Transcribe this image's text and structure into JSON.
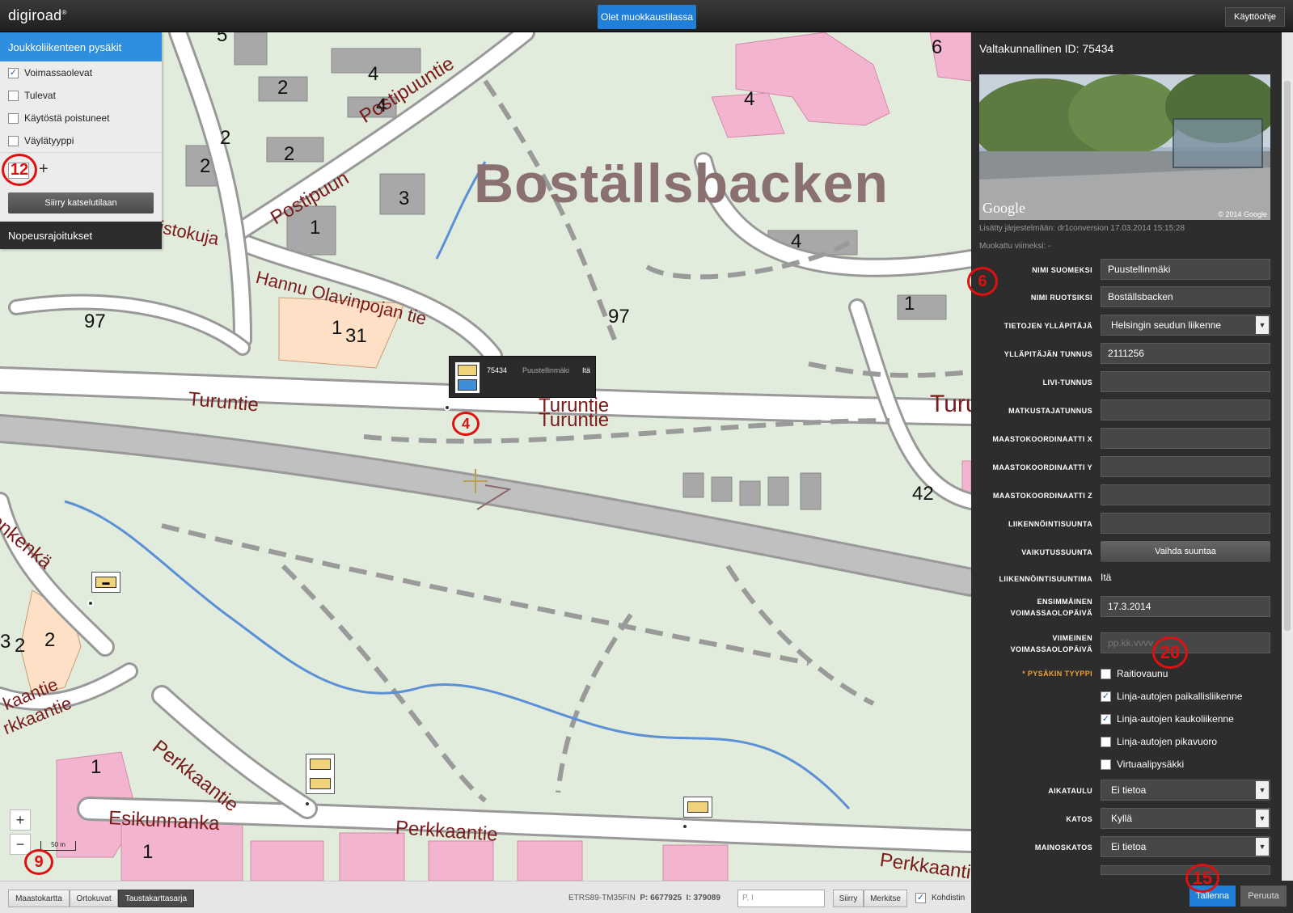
{
  "app": {
    "logo": "digiroad",
    "logo_mark": "®",
    "edit_mode": "Olet muokkaustilassa",
    "help": "Käyttöohje"
  },
  "legend": {
    "title": "Joukkoliikenteen pysäkit",
    "items": [
      {
        "label": "Voimassaolevat",
        "checked": true
      },
      {
        "label": "Tulevat",
        "checked": false
      },
      {
        "label": "Käytöstä poistuneet",
        "checked": false
      },
      {
        "label": "Väylätyyppi",
        "checked": false
      }
    ],
    "add": "+",
    "move_button": "Siirry katselutilaan",
    "second_title": "Nopeusrajoitukset"
  },
  "map": {
    "place_name": "Boställsbacken",
    "roads": [
      "Postipuuntie",
      "Postipuun",
      "Hannu Olavinpojan tie",
      "Turuntie",
      "Turuntie",
      "Turuntie",
      "Perkkaantie",
      "Perkkaantie",
      "Perkkaantie",
      "Esikunnanka",
      "Turu",
      "istokuja",
      "enkenkä",
      "kaantie",
      "rkkaantie"
    ],
    "numbers": [
      "5",
      "4",
      "2",
      "4",
      "2",
      "2",
      "2",
      "3",
      "1",
      "97",
      "1",
      "31",
      "97",
      "4",
      "4",
      "1",
      "6",
      "42",
      "3",
      "2",
      "2",
      "1",
      "1"
    ],
    "popup": {
      "id": "75434",
      "name": "Puustellinmäki",
      "direction": "Itä"
    },
    "scale_label": "50 m",
    "zoom_in": "+",
    "zoom_out": "−"
  },
  "annotations": [
    "12",
    "4",
    "6",
    "9",
    "20",
    "15"
  ],
  "panel": {
    "title": "Valtakunnallinen ID: 75434",
    "streetview_brand": "Google",
    "streetview_copyright": "© 2014 Google",
    "added": "Lisätty järjestelmään: dr1conversion 17.03.2014 15:15:28",
    "modified": "Muokattu viimeksi: -",
    "fields": {
      "nimi_fi": {
        "label": "NIMI SUOMEKSI",
        "value": "Puustellinmäki"
      },
      "nimi_sv": {
        "label": "NIMI RUOTSIKSI",
        "value": "Boställsbacken"
      },
      "yllapitaja": {
        "label": "TIETOJEN YLLÄPITÄJÄ",
        "value": "Helsingin seudun liikenne"
      },
      "tunnus": {
        "label": "YLLÄPITÄJÄN TUNNUS",
        "value": "2111256"
      },
      "livi": {
        "label": "LIVI-TUNNUS",
        "value": ""
      },
      "matkustaja": {
        "label": "MATKUSTAJATUNNUS",
        "value": ""
      },
      "x": {
        "label": "MAASTOKOORDINAATTI X",
        "value": ""
      },
      "y": {
        "label": "MAASTOKOORDINAATTI Y",
        "value": ""
      },
      "z": {
        "label": "MAASTOKOORDINAATTI Z",
        "value": ""
      },
      "suunta": {
        "label": "LIIKENNÖINTISUUNTA",
        "value": ""
      },
      "vaikutus": {
        "label": "VAIKUTUSSUUNTA",
        "button": "Vaihda suuntaa"
      },
      "suuntima": {
        "label": "LIIKENNÖINTISUUNTIMA",
        "value": "Itä"
      },
      "ensimmainen": {
        "label1": "ENSIMMÄINEN",
        "label2": "VOIMASSAOLOPÄIVÄ",
        "value": "17.3.2014"
      },
      "viimeinen": {
        "label1": "VIIMEINEN",
        "label2": "VOIMASSAOLOPÄIVÄ",
        "placeholder": "pp.kk.vvvv"
      },
      "tyyppi": {
        "label": "* PYSÄKIN TYYPPI",
        "options": [
          {
            "label": "Raitiovaunu",
            "checked": false
          },
          {
            "label": "Linja-autojen paikallisliikenne",
            "checked": true
          },
          {
            "label": "Linja-autojen kaukoliikenne",
            "checked": true
          },
          {
            "label": "Linja-autojen pikavuoro",
            "checked": false
          },
          {
            "label": "Virtuaalipysäkki",
            "checked": false
          }
        ]
      },
      "aikataulu": {
        "label": "AIKATAULU",
        "value": "Ei tietoa"
      },
      "katos": {
        "label": "KATOS",
        "value": "Kyllä"
      },
      "mainoskatos": {
        "label": "MAINOSKATOS",
        "value": "Ei tietoa"
      }
    },
    "save": "Tallenna",
    "cancel": "Peruuta"
  },
  "bottom": {
    "layers": [
      "Maastokartta",
      "Ortokuvat",
      "Taustakarttasarja"
    ],
    "active_layer": "Taustakarttasarja",
    "crs": "ETRS89-TM35FIN",
    "p_label": "P:",
    "p_value": "6677925",
    "i_label": "I:",
    "i_value": "379089",
    "coord_placeholder": "P, I",
    "move": "Siirry",
    "mark": "Merkitse",
    "target": "Kohdistin"
  },
  "colors": {
    "accent": "#1f7fd9",
    "panel": "#2d2d2d",
    "road_label": "#7a1a1a",
    "building": "#f2b4cf",
    "annotation": "#e01010"
  }
}
